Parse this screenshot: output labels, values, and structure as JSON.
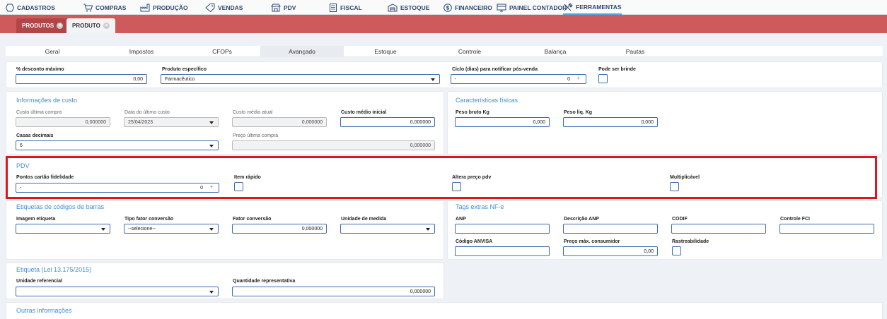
{
  "menu": [
    {
      "label": "CADASTROS",
      "icon": "hexagon-icon"
    },
    {
      "label": "COMPRAS",
      "icon": "cart-icon"
    },
    {
      "label": "PRODUÇÃO",
      "icon": "factory-icon"
    },
    {
      "label": "VENDAS",
      "icon": "tag-icon"
    },
    {
      "label": "PDV",
      "icon": "store-icon"
    },
    {
      "label": "FISCAL",
      "icon": "document-icon"
    },
    {
      "label": "ESTOQUE",
      "icon": "warehouse-icon"
    },
    {
      "label": "FINANCEIRO",
      "icon": "dollar-icon"
    },
    {
      "label": "PAINEL CONTADOR",
      "icon": "panel-icon"
    },
    {
      "label": "FERRAMENTAS",
      "icon": "tools-icon"
    }
  ],
  "page_tabs": {
    "produtos": "PRODUTOS",
    "produto": "PRODUTO",
    "close_glyph": "×"
  },
  "sub_tabs": [
    "Geral",
    "Impostos",
    "CFOPs",
    "Avançado",
    "Estoque",
    "Controle",
    "Balança",
    "Pautas"
  ],
  "active_sub_tab": "Avançado",
  "top_row": {
    "desconto_label": "% desconto máximo",
    "desconto_value": "0,00",
    "produto_especifico_label": "Produto específico",
    "produto_especifico_value": "Farmacêutico",
    "ciclo_label": "Ciclo (dias) para notificar pós-venda",
    "ciclo_prefix": "-",
    "ciclo_value": "0",
    "ciclo_spin": "+",
    "brinde_label": "Pode ser brinde"
  },
  "custo": {
    "title": "Informações de custo",
    "ultima_compra_label": "Custo última compra",
    "ultima_compra_value": "0,000000",
    "data_label": "Data do último custo",
    "data_value": "25/04/2023",
    "medio_atual_label": "Custo médio atual",
    "medio_atual_value": "0,000000",
    "medio_inicial_label": "Custo médio inicial",
    "medio_inicial_value": "0,000000",
    "casas_label": "Casas decimais",
    "casas_value": "6",
    "preco_ultima_label": "Preço última compra",
    "preco_ultima_value": "0,000000"
  },
  "fisicas": {
    "title": "Características físicas",
    "bruto_label": "Peso bruto Kg",
    "bruto_value": "0,000",
    "liq_label": "Peso líq. Kg",
    "liq_value": "0,000"
  },
  "pdv": {
    "title": "PDV",
    "pontos_label": "Pontos cartão fidelidade",
    "pontos_prefix": "-",
    "pontos_value": "0",
    "pontos_spin": "+",
    "item_rapido_label": "Item rápido",
    "altera_preco_label": "Altera preço pdv",
    "multiplicavel_label": "Multiplicável",
    "highlight_color": "#e0151c"
  },
  "etiquetas": {
    "title": "Etiquetas de códigos de barras",
    "imagem_label": "Imagem etiqueta",
    "tipo_label": "Tipo fator conversão",
    "tipo_value": "--selecione--",
    "fator_label": "Fator conversão",
    "fator_value": "0,000000",
    "unidade_label": "Unidade de medida"
  },
  "tags": {
    "title": "Tags extras NF-e",
    "anp_label": "ANP",
    "desc_anp_label": "Descrição ANP",
    "codif_label": "CODIF",
    "fci_label": "Controle FCI",
    "anvisa_label": "Código ANVISA",
    "preco_max_label": "Preço máx. consumidor",
    "preco_max_value": "0,00",
    "rastre_label": "Rastreabilidade"
  },
  "lei": {
    "title": "Etiqueta (Lei 13.175/2015)",
    "unidade_label": "Unidade referencial",
    "quantidade_label": "Quantidade representativa",
    "quantidade_value": "0,000000"
  },
  "outras": {
    "title": "Outras informações"
  },
  "colors": {
    "tab_bar": "#cf5a5c",
    "accent": "#3f8fd8",
    "input_border": "#3c6cb0"
  }
}
